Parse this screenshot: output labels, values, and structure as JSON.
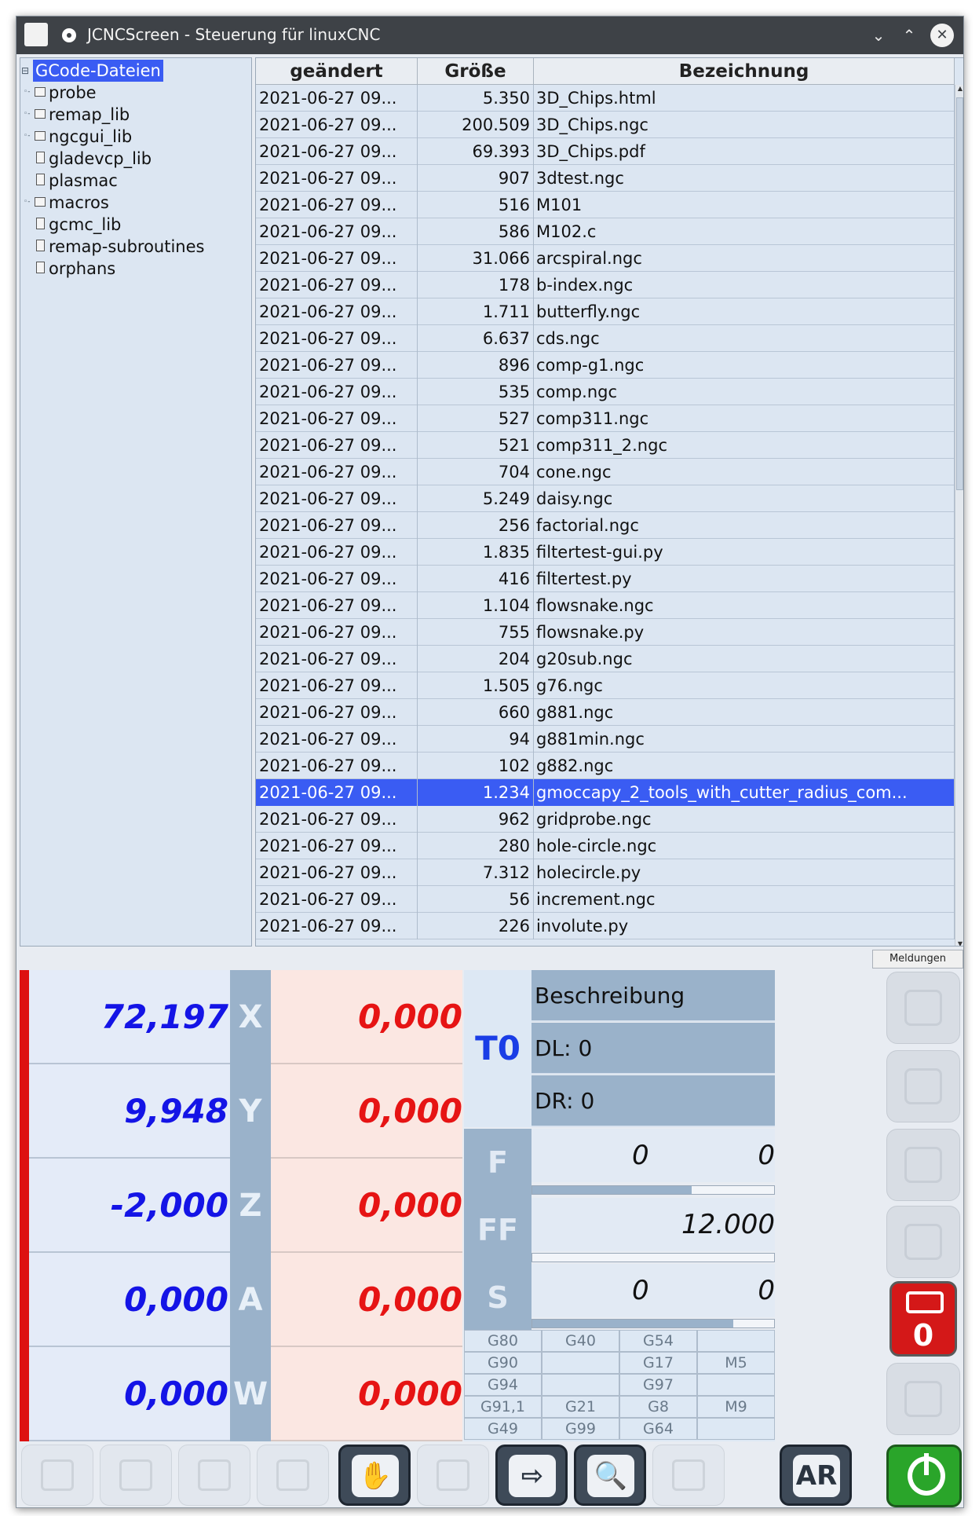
{
  "window": {
    "title": "JCNCScreen - Steuerung für linuxCNC"
  },
  "tree": {
    "root": "GCode-Dateien",
    "items": [
      {
        "label": "probe",
        "type": "folder"
      },
      {
        "label": "remap_lib",
        "type": "folder"
      },
      {
        "label": "ngcgui_lib",
        "type": "folder"
      },
      {
        "label": "gladevcp_lib",
        "type": "file"
      },
      {
        "label": "plasmac",
        "type": "file"
      },
      {
        "label": "macros",
        "type": "folder"
      },
      {
        "label": "gcmc_lib",
        "type": "file"
      },
      {
        "label": "remap-subroutines",
        "type": "file"
      },
      {
        "label": "orphans",
        "type": "file"
      }
    ]
  },
  "table": {
    "headers": [
      "geändert",
      "Größe",
      "Bezeichnung"
    ],
    "rows": [
      [
        "2021-06-27 09...",
        "5.350",
        "3D_Chips.html"
      ],
      [
        "2021-06-27 09...",
        "200.509",
        "3D_Chips.ngc"
      ],
      [
        "2021-06-27 09...",
        "69.393",
        "3D_Chips.pdf"
      ],
      [
        "2021-06-27 09...",
        "907",
        "3dtest.ngc"
      ],
      [
        "2021-06-27 09...",
        "516",
        "M101"
      ],
      [
        "2021-06-27 09...",
        "586",
        "M102.c"
      ],
      [
        "2021-06-27 09...",
        "31.066",
        "arcspiral.ngc"
      ],
      [
        "2021-06-27 09...",
        "178",
        "b-index.ngc"
      ],
      [
        "2021-06-27 09...",
        "1.711",
        "butterfly.ngc"
      ],
      [
        "2021-06-27 09...",
        "6.637",
        "cds.ngc"
      ],
      [
        "2021-06-27 09...",
        "896",
        "comp-g1.ngc"
      ],
      [
        "2021-06-27 09...",
        "535",
        "comp.ngc"
      ],
      [
        "2021-06-27 09...",
        "527",
        "comp311.ngc"
      ],
      [
        "2021-06-27 09...",
        "521",
        "comp311_2.ngc"
      ],
      [
        "2021-06-27 09...",
        "704",
        "cone.ngc"
      ],
      [
        "2021-06-27 09...",
        "5.249",
        "daisy.ngc"
      ],
      [
        "2021-06-27 09...",
        "256",
        "factorial.ngc"
      ],
      [
        "2021-06-27 09...",
        "1.835",
        "filtertest-gui.py"
      ],
      [
        "2021-06-27 09...",
        "416",
        "filtertest.py"
      ],
      [
        "2021-06-27 09...",
        "1.104",
        "flowsnake.ngc"
      ],
      [
        "2021-06-27 09...",
        "755",
        "flowsnake.py"
      ],
      [
        "2021-06-27 09...",
        "204",
        "g20sub.ngc"
      ],
      [
        "2021-06-27 09...",
        "1.505",
        "g76.ngc"
      ],
      [
        "2021-06-27 09...",
        "660",
        "g881.ngc"
      ],
      [
        "2021-06-27 09...",
        "94",
        "g881min.ngc"
      ],
      [
        "2021-06-27 09...",
        "102",
        "g882.ngc"
      ],
      [
        "2021-06-27 09...",
        "1.234",
        "gmoccapy_2_tools_with_cutter_radius_com..."
      ],
      [
        "2021-06-27 09...",
        "962",
        "gridprobe.ngc"
      ],
      [
        "2021-06-27 09...",
        "280",
        "hole-circle.ngc"
      ],
      [
        "2021-06-27 09...",
        "7.312",
        "holecircle.py"
      ],
      [
        "2021-06-27 09...",
        "56",
        "increment.ngc"
      ],
      [
        "2021-06-27 09...",
        "226",
        "involute.py"
      ]
    ],
    "selected_index": 26
  },
  "meldungen_label": "Meldungen",
  "dro": [
    {
      "value": "72,197",
      "axis": "X",
      "dtg": "0,000"
    },
    {
      "value": "9,948",
      "axis": "Y",
      "dtg": "0,000"
    },
    {
      "value": "-2,000",
      "axis": "Z",
      "dtg": "0,000"
    },
    {
      "value": "0,000",
      "axis": "A",
      "dtg": "0,000"
    },
    {
      "value": "0,000",
      "axis": "W",
      "dtg": "0,000"
    }
  ],
  "tool": {
    "number": "T0",
    "description": "Beschreibung",
    "dl": "DL: 0",
    "dr": "DR: 0"
  },
  "feed": {
    "f_label": "F",
    "f_value": "0",
    "f_value2": "0",
    "f_bar": 0.66,
    "ff_label": "FF",
    "ff_value": "12.000",
    "ff_bar": 0.0,
    "s_label": "S",
    "s_value": "0",
    "s_value2": "0",
    "s_bar": 0.83
  },
  "gcodes": [
    [
      "G80",
      "G40",
      "G54",
      ""
    ],
    [
      "G90",
      "",
      "G17",
      "M5"
    ],
    [
      "G94",
      "",
      "G97",
      ""
    ],
    [
      "G91,1",
      "G21",
      "G8",
      "M9"
    ],
    [
      "G49",
      "G99",
      "G64",
      ""
    ]
  ],
  "stop_button": {
    "value": "0"
  },
  "bottom_toolbar": {
    "auto_label": "AR"
  },
  "colors": {
    "accent": "#3a5cf3",
    "dro_value": "#1414e6",
    "dro_dtg": "#e61414",
    "power": "#2aa52a",
    "stop": "#d41818"
  }
}
